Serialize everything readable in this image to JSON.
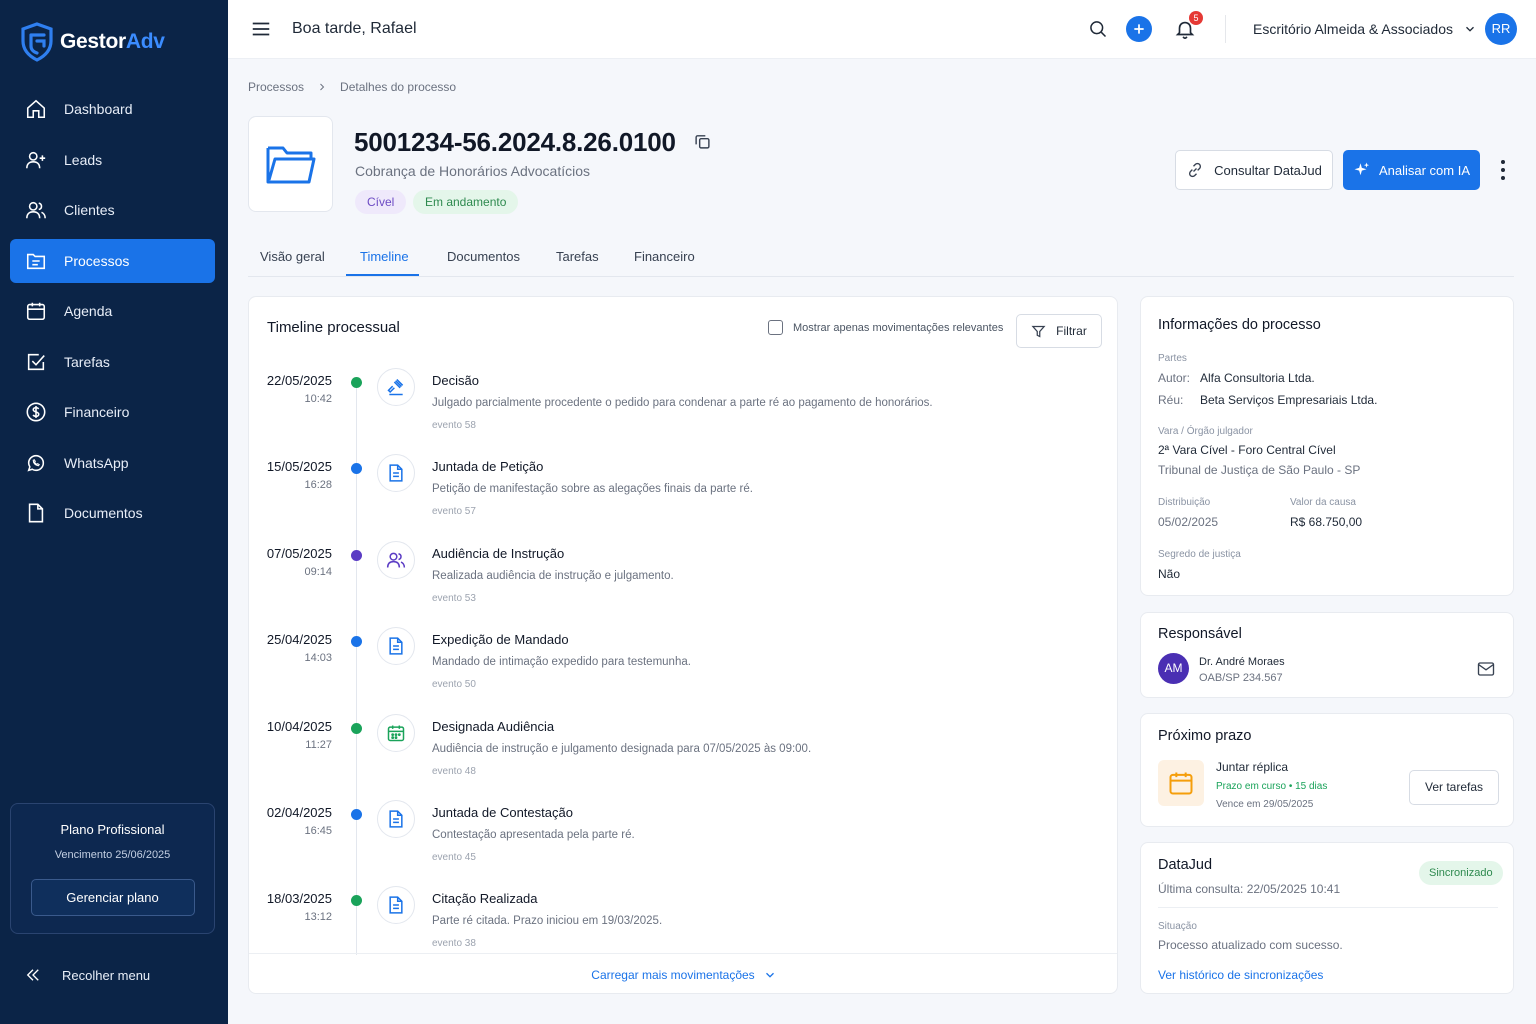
{
  "brand": {
    "name_part1": "Gestor",
    "name_part2": "Adv"
  },
  "sidebar": {
    "items": [
      {
        "label": "Dashboard",
        "icon": "home-icon"
      },
      {
        "label": "Leads",
        "icon": "user-plus-icon"
      },
      {
        "label": "Clientes",
        "icon": "users-icon"
      },
      {
        "label": "Processos",
        "icon": "folder-icon",
        "active": true
      },
      {
        "label": "Agenda",
        "icon": "calendar-icon"
      },
      {
        "label": "Tarefas",
        "icon": "checkbox-icon"
      },
      {
        "label": "Financeiro",
        "icon": "dollar-icon"
      },
      {
        "label": "WhatsApp",
        "icon": "whatsapp-icon"
      },
      {
        "label": "Documentos",
        "icon": "document-icon"
      }
    ],
    "plan": {
      "title": "Plano Profissional",
      "expiry": "Vencimento 25/06/2025",
      "button": "Gerenciar plano"
    },
    "collapse_label": "Recolher menu"
  },
  "topbar": {
    "greeting": "Boa tarde, Rafael",
    "notification_count": "5",
    "office": "Escritório Almeida & Associados",
    "user_initials": "RR"
  },
  "breadcrumb": {
    "items": [
      "Processos",
      "Detalhes do processo"
    ]
  },
  "process": {
    "number": "5001234-56.2024.8.26.0100",
    "subject": "Cobrança de Honorários Advocatícios",
    "tags": [
      "Cível",
      "Em andamento"
    ],
    "btn_datajud": "Consultar DataJud",
    "btn_ai": "Analisar com IA"
  },
  "tabs": [
    "Visão geral",
    "Timeline",
    "Documentos",
    "Tarefas",
    "Financeiro"
  ],
  "active_tab": "Timeline",
  "timeline": {
    "title": "Timeline processual",
    "checkbox_label": "Mostrar apenas movimentações relevantes",
    "filter_label": "Filtrar",
    "load_more": "Carregar mais movimentações",
    "events": [
      {
        "date": "22/05/2025",
        "time": "10:42",
        "title": "Decisão",
        "desc": "Julgado parcialmente procedente o pedido para condenar a parte ré ao pagamento de honorários.",
        "event": "evento 58",
        "dot_color": "#1aa35a",
        "icon": "gavel-icon"
      },
      {
        "date": "15/05/2025",
        "time": "16:28",
        "title": "Juntada de Petição",
        "desc": "Petição de manifestação sobre as alegações finais da parte ré.",
        "event": "evento 57",
        "dot_color": "#1a73e8",
        "icon": "document-icon"
      },
      {
        "date": "07/05/2025",
        "time": "09:14",
        "title": "Audiência de Instrução",
        "desc": "Realizada audiência de instrução e julgamento.",
        "event": "evento 53",
        "dot_color": "#5b3cc4",
        "icon": "users-icon"
      },
      {
        "date": "25/04/2025",
        "time": "14:03",
        "title": "Expedição de Mandado",
        "desc": "Mandado de intimação expedido para testemunha.",
        "event": "evento 50",
        "dot_color": "#1a73e8",
        "icon": "document-icon"
      },
      {
        "date": "10/04/2025",
        "time": "11:27",
        "title": "Designada Audiência",
        "desc": "Audiência de instrução e julgamento designada para 07/05/2025 às 09:00.",
        "event": "evento 48",
        "dot_color": "#1aa35a",
        "icon": "calendar-icon"
      },
      {
        "date": "02/04/2025",
        "time": "16:45",
        "title": "Juntada de Contestação",
        "desc": "Contestação apresentada pela parte ré.",
        "event": "evento 45",
        "dot_color": "#1a73e8",
        "icon": "document-icon"
      },
      {
        "date": "18/03/2025",
        "time": "13:12",
        "title": "Citação Realizada",
        "desc": "Parte ré citada. Prazo iniciou em 19/03/2025.",
        "event": "evento 38",
        "dot_color": "#1aa35a",
        "icon": "document-icon"
      }
    ]
  },
  "info": {
    "title": "Informações do processo",
    "parties_label": "Partes",
    "author_label": "Autor:",
    "author": "Alfa Consultoria Ltda.",
    "defendant_label": "Réu:",
    "defendant": "Beta Serviços Empresariais Ltda.",
    "court_label": "Vara / Órgão julgador",
    "court": "2ª Vara Cível - Foro Central Cível",
    "tribunal": "Tribunal de Justiça de São Paulo - SP",
    "distribution_label": "Distribuição",
    "distribution": "05/02/2025",
    "value_label": "Valor da causa",
    "value": "R$ 68.750,00",
    "secrecy_label": "Segredo de justiça",
    "secrecy": "Não"
  },
  "responsible": {
    "title": "Responsável",
    "initials": "AM",
    "name": "Dr. André Moraes",
    "oab": "OAB/SP 234.567"
  },
  "deadline": {
    "title": "Próximo prazo",
    "task": "Juntar réplica",
    "status": "Prazo em curso",
    "days": "15 dias",
    "due": "Vence em 29/05/2025",
    "button": "Ver tarefas"
  },
  "datajud": {
    "title": "DataJud",
    "badge": "Sincronizado",
    "last_query": "Última consulta: 22/05/2025 10:41",
    "situation_label": "Situação",
    "situation": "Processo atualizado com sucesso.",
    "history_link": "Ver histórico de sincronizações"
  },
  "colors": {
    "sidebar_bg": "#0b2447",
    "accent": "#1a73e8",
    "success": "#1aa35a",
    "purple": "#5b3cc4"
  }
}
